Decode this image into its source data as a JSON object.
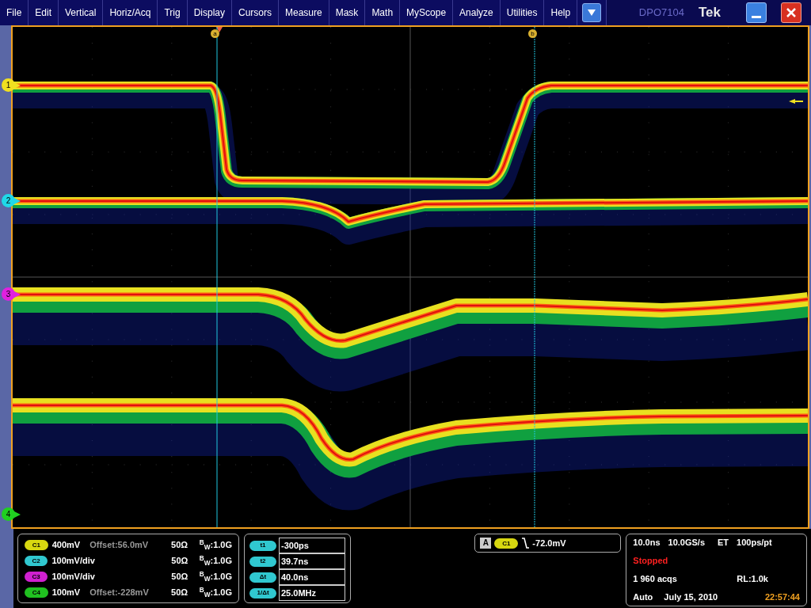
{
  "menu": [
    "File",
    "Edit",
    "Vertical",
    "Horiz/Acq",
    "Trig",
    "Display",
    "Cursors",
    "Measure",
    "Mask",
    "Math",
    "MyScope",
    "Analyze",
    "Utilities",
    "Help"
  ],
  "title_bar": {
    "model": "DPO7104",
    "brand": "Tek"
  },
  "channel_markers": [
    {
      "label": "1",
      "color": "#f0e020"
    },
    {
      "label": "2",
      "color": "#20d8e8"
    },
    {
      "label": "3",
      "color": "#e020e0"
    },
    {
      "label": "4",
      "color": "#20d020"
    }
  ],
  "cursors": [
    {
      "label": "a"
    },
    {
      "label": "b"
    }
  ],
  "channels": [
    {
      "label": "C1",
      "color": "#d8d810",
      "scale": "400mV",
      "offset": "Offset:56.0mV",
      "impedance": "50Ω",
      "bandwidth": "$^{B}$$_{W}$:1.0G"
    },
    {
      "label": "C2",
      "color": "#30c8d0",
      "scale": "100mV/div",
      "impedance": "50Ω",
      "bandwidth": "$^{B}$$_{W}$:1.0G"
    },
    {
      "label": "C3",
      "color": "#d020d0",
      "scale": "100mV/div",
      "impedance": "50Ω",
      "bandwidth": "$^{B}$$_{W}$:1.0G"
    },
    {
      "label": "C4",
      "color": "#20c020",
      "scale": "100mV",
      "offset": "Offset:-228mV",
      "impedance": "50Ω",
      "bandwidth": "$^{B}$$_{W}$:1.0G"
    }
  ],
  "cursor_readouts": [
    {
      "label": "t1",
      "value": "-300ps"
    },
    {
      "label": "t2",
      "value": "39.7ns"
    },
    {
      "label": "Δt",
      "value": "40.0ns"
    },
    {
      "label": "1/Δt",
      "value": "25.0MHz"
    }
  ],
  "trigger": {
    "mode": "A",
    "source": {
      "label": "C1",
      "color": "#d8d810"
    },
    "level": "-72.0mV"
  },
  "acquisition": {
    "timebase": "10.0ns",
    "sample_rate": "10.0GS/s",
    "mode": "ET",
    "resolution": "100ps/pt",
    "state": "Stopped",
    "acqs": "1 960 acqs",
    "record_length": "RL:1.0k",
    "trigger_mode": "Auto",
    "date": "July 15, 2010",
    "time": "22:57:44"
  }
}
